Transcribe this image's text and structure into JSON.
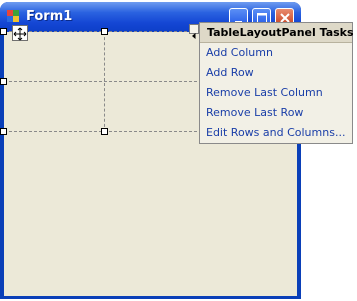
{
  "window": {
    "title": "Form1",
    "icon": "form-app-icon",
    "controls": [
      "minimize-icon",
      "maximize-icon",
      "close-icon"
    ]
  },
  "smart_panel": {
    "title": "TableLayoutPanel Tasks",
    "items": [
      "Add Column",
      "Add Row",
      "Remove Last Column",
      "Remove Last Row",
      "Edit Rows and Columns..."
    ]
  },
  "colors": {
    "titlebar": "#1446d4",
    "client": "#ece9d8",
    "link": "#1a3ea8",
    "panel_header": "#ded9c8"
  }
}
